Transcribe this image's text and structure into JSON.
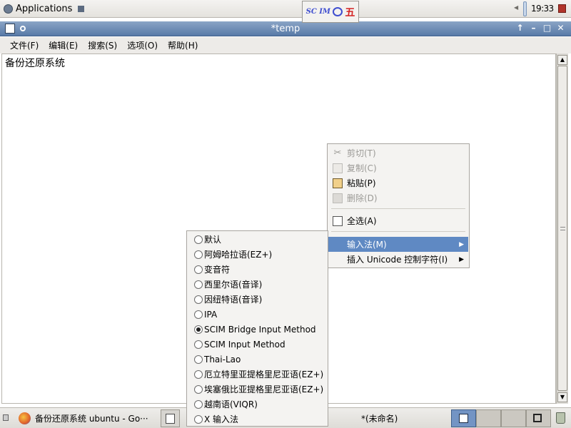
{
  "top_panel": {
    "applications_label": "Applications",
    "scim_logo": "SC IM",
    "scim_mode_symbol": "五",
    "clock": "19:33"
  },
  "window": {
    "title": "*temp",
    "menu": [
      "文件(F)",
      "编辑(E)",
      "搜索(S)",
      "选项(O)",
      "帮助(H)"
    ]
  },
  "editor": {
    "content": "备份还原系统"
  },
  "context_menu": {
    "items": [
      {
        "label": "剪切(T)",
        "enabled": false
      },
      {
        "label": "复制(C)",
        "enabled": false
      },
      {
        "label": "粘贴(P)",
        "enabled": true
      },
      {
        "label": "删除(D)",
        "enabled": false
      },
      {
        "label": "全选(A)",
        "enabled": true
      },
      {
        "label": "输入法(M)",
        "enabled": true,
        "highlighted": true,
        "submenu": true
      },
      {
        "label": "插入 Unicode 控制字符(I)",
        "enabled": true,
        "submenu": true
      }
    ]
  },
  "input_method_submenu": {
    "selected": "SCIM Bridge Input Method",
    "items": [
      "默认",
      "阿姆哈拉语(EZ+)",
      "变音符",
      "西里尔语(音译)",
      "因纽特语(音译)",
      "IPA",
      "SCIM Bridge Input Method",
      "SCIM Input Method",
      "Thai-Lao",
      "厄立特里亚提格里尼亚语(EZ+)",
      "埃塞俄比亚提格里尼亚语(EZ+)",
      "越南语(VIQR)",
      "X 输入法"
    ]
  },
  "bottom_panel": {
    "tasks": [
      {
        "label": "备份还原系统 ubuntu - Go···",
        "icon": "firefox-icon"
      },
      {
        "label": "",
        "icon": "terminal-icon"
      },
      {
        "label": "*(未命名)",
        "icon": ""
      }
    ]
  }
}
